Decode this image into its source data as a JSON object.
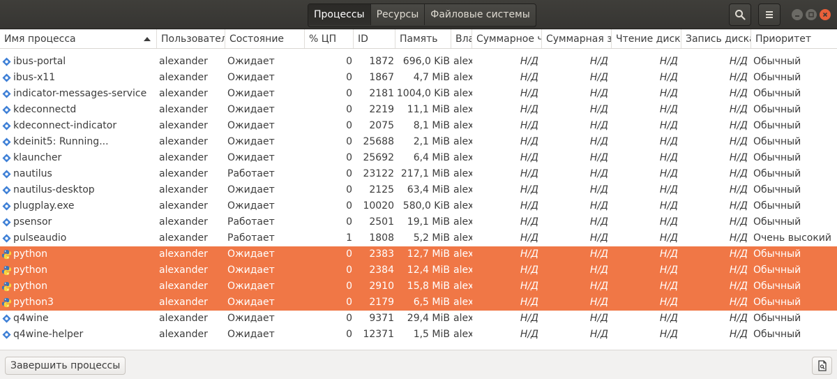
{
  "tabs": [
    "Процессы",
    "Ресурсы",
    "Файловые системы"
  ],
  "columns": [
    "Имя процесса",
    "Пользовател",
    "Состояние",
    "% ЦП",
    "ID",
    "Память",
    "Вла",
    "Суммарное чт",
    "Суммарная за",
    "Чтение диска",
    "Запись диска",
    "Приоритет"
  ],
  "rows": [
    {
      "name": "ibus-portal",
      "user": "alexander",
      "state": "Ожидает",
      "cpu": "0",
      "id": "1872",
      "mem": "696,0 KiB",
      "owner": "alex",
      "tr": "Н/Д",
      "tw": "Н/Д",
      "dr": "Н/Д",
      "dw": "Н/Д",
      "prio": "Обычный",
      "icon": "gear",
      "selected": false
    },
    {
      "name": "ibus-x11",
      "user": "alexander",
      "state": "Ожидает",
      "cpu": "0",
      "id": "1867",
      "mem": "4,7 MiB",
      "owner": "alex",
      "tr": "Н/Д",
      "tw": "Н/Д",
      "dr": "Н/Д",
      "dw": "Н/Д",
      "prio": "Обычный",
      "icon": "gear",
      "selected": false
    },
    {
      "name": "indicator-messages-service",
      "user": "alexander",
      "state": "Ожидает",
      "cpu": "0",
      "id": "2181",
      "mem": "1004,0 KiB",
      "owner": "alex",
      "tr": "Н/Д",
      "tw": "Н/Д",
      "dr": "Н/Д",
      "dw": "Н/Д",
      "prio": "Обычный",
      "icon": "gear",
      "selected": false
    },
    {
      "name": "kdeconnectd",
      "user": "alexander",
      "state": "Ожидает",
      "cpu": "0",
      "id": "2219",
      "mem": "11,1 MiB",
      "owner": "alex",
      "tr": "Н/Д",
      "tw": "Н/Д",
      "dr": "Н/Д",
      "dw": "Н/Д",
      "prio": "Обычный",
      "icon": "gear",
      "selected": false
    },
    {
      "name": "kdeconnect-indicator",
      "user": "alexander",
      "state": "Ожидает",
      "cpu": "0",
      "id": "2075",
      "mem": "8,1 MiB",
      "owner": "alex",
      "tr": "Н/Д",
      "tw": "Н/Д",
      "dr": "Н/Д",
      "dw": "Н/Д",
      "prio": "Обычный",
      "icon": "gear",
      "selected": false
    },
    {
      "name": "kdeinit5: Running...",
      "user": "alexander",
      "state": "Ожидает",
      "cpu": "0",
      "id": "25688",
      "mem": "2,1 MiB",
      "owner": "alex",
      "tr": "Н/Д",
      "tw": "Н/Д",
      "dr": "Н/Д",
      "dw": "Н/Д",
      "prio": "Обычный",
      "icon": "gear",
      "selected": false
    },
    {
      "name": "klauncher",
      "user": "alexander",
      "state": "Ожидает",
      "cpu": "0",
      "id": "25692",
      "mem": "6,4 MiB",
      "owner": "alex",
      "tr": "Н/Д",
      "tw": "Н/Д",
      "dr": "Н/Д",
      "dw": "Н/Д",
      "prio": "Обычный",
      "icon": "gear",
      "selected": false
    },
    {
      "name": "nautilus",
      "user": "alexander",
      "state": "Работает",
      "cpu": "0",
      "id": "23122",
      "mem": "217,1 MiB",
      "owner": "alex",
      "tr": "Н/Д",
      "tw": "Н/Д",
      "dr": "Н/Д",
      "dw": "Н/Д",
      "prio": "Обычный",
      "icon": "gear",
      "selected": false
    },
    {
      "name": "nautilus-desktop",
      "user": "alexander",
      "state": "Ожидает",
      "cpu": "0",
      "id": "2125",
      "mem": "63,4 MiB",
      "owner": "alex",
      "tr": "Н/Д",
      "tw": "Н/Д",
      "dr": "Н/Д",
      "dw": "Н/Д",
      "prio": "Обычный",
      "icon": "gear",
      "selected": false
    },
    {
      "name": "plugplay.exe",
      "user": "alexander",
      "state": "Ожидает",
      "cpu": "0",
      "id": "10020",
      "mem": "580,0 KiB",
      "owner": "alex",
      "tr": "Н/Д",
      "tw": "Н/Д",
      "dr": "Н/Д",
      "dw": "Н/Д",
      "prio": "Обычный",
      "icon": "gear",
      "selected": false
    },
    {
      "name": "psensor",
      "user": "alexander",
      "state": "Работает",
      "cpu": "0",
      "id": "2501",
      "mem": "19,1 MiB",
      "owner": "alex",
      "tr": "Н/Д",
      "tw": "Н/Д",
      "dr": "Н/Д",
      "dw": "Н/Д",
      "prio": "Обычный",
      "icon": "gear",
      "selected": false
    },
    {
      "name": "pulseaudio",
      "user": "alexander",
      "state": "Работает",
      "cpu": "1",
      "id": "1808",
      "mem": "5,2 MiB",
      "owner": "alex",
      "tr": "Н/Д",
      "tw": "Н/Д",
      "dr": "Н/Д",
      "dw": "Н/Д",
      "prio": "Очень высокий",
      "icon": "gear",
      "selected": false
    },
    {
      "name": "python",
      "user": "alexander",
      "state": "Ожидает",
      "cpu": "0",
      "id": "2383",
      "mem": "12,7 MiB",
      "owner": "alex",
      "tr": "Н/Д",
      "tw": "Н/Д",
      "dr": "Н/Д",
      "dw": "Н/Д",
      "prio": "Обычный",
      "icon": "python",
      "selected": true
    },
    {
      "name": "python",
      "user": "alexander",
      "state": "Ожидает",
      "cpu": "0",
      "id": "2384",
      "mem": "12,4 MiB",
      "owner": "alex",
      "tr": "Н/Д",
      "tw": "Н/Д",
      "dr": "Н/Д",
      "dw": "Н/Д",
      "prio": "Обычный",
      "icon": "python",
      "selected": true
    },
    {
      "name": "python",
      "user": "alexander",
      "state": "Ожидает",
      "cpu": "0",
      "id": "2910",
      "mem": "15,8 MiB",
      "owner": "alex",
      "tr": "Н/Д",
      "tw": "Н/Д",
      "dr": "Н/Д",
      "dw": "Н/Д",
      "prio": "Обычный",
      "icon": "python",
      "selected": true
    },
    {
      "name": "python3",
      "user": "alexander",
      "state": "Ожидает",
      "cpu": "0",
      "id": "2179",
      "mem": "6,5 MiB",
      "owner": "alex",
      "tr": "Н/Д",
      "tw": "Н/Д",
      "dr": "Н/Д",
      "dw": "Н/Д",
      "prio": "Обычный",
      "icon": "python",
      "selected": true
    },
    {
      "name": "q4wine",
      "user": "alexander",
      "state": "Ожидает",
      "cpu": "0",
      "id": "9371",
      "mem": "29,4 MiB",
      "owner": "alex",
      "tr": "Н/Д",
      "tw": "Н/Д",
      "dr": "Н/Д",
      "dw": "Н/Д",
      "prio": "Обычный",
      "icon": "gear",
      "selected": false
    },
    {
      "name": "q4wine-helper",
      "user": "alexander",
      "state": "Ожидает",
      "cpu": "0",
      "id": "12371",
      "mem": "1,5 MiB",
      "owner": "alex",
      "tr": "Н/Д",
      "tw": "Н/Д",
      "dr": "Н/Д",
      "dw": "Н/Д",
      "prio": "Обычный",
      "icon": "gear",
      "selected": false
    }
  ],
  "footer": {
    "end_button": "Завершить процессы"
  },
  "icons": {
    "search": "search-icon",
    "menu": "menu-icon",
    "minimize": "minimize-icon",
    "maximize": "maximize-icon",
    "close": "close-icon",
    "info": "process-info-icon"
  },
  "colors": {
    "selection": "#f07746",
    "titlebar": "#3c3b37",
    "accent_close": "#e9603a"
  }
}
